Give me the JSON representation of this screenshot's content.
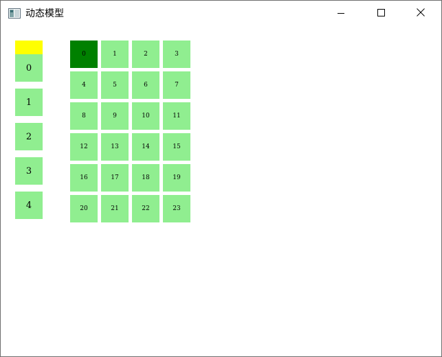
{
  "window": {
    "title": "动态模型",
    "icons": {
      "app": "window-app-icon",
      "minimize": "minimize-icon",
      "maximize": "maximize-icon",
      "close": "close-icon"
    }
  },
  "colors": {
    "cell": "#90ee90",
    "selected_cell": "#008000",
    "marker": "#ffff00"
  },
  "left_list": {
    "items": [
      "0",
      "1",
      "2",
      "3",
      "4"
    ]
  },
  "grid": {
    "columns": 4,
    "selected_index": 0,
    "cells": [
      "0",
      "1",
      "2",
      "3",
      "4",
      "5",
      "6",
      "7",
      "8",
      "9",
      "10",
      "11",
      "12",
      "13",
      "14",
      "15",
      "16",
      "17",
      "18",
      "19",
      "20",
      "21",
      "22",
      "23"
    ]
  }
}
